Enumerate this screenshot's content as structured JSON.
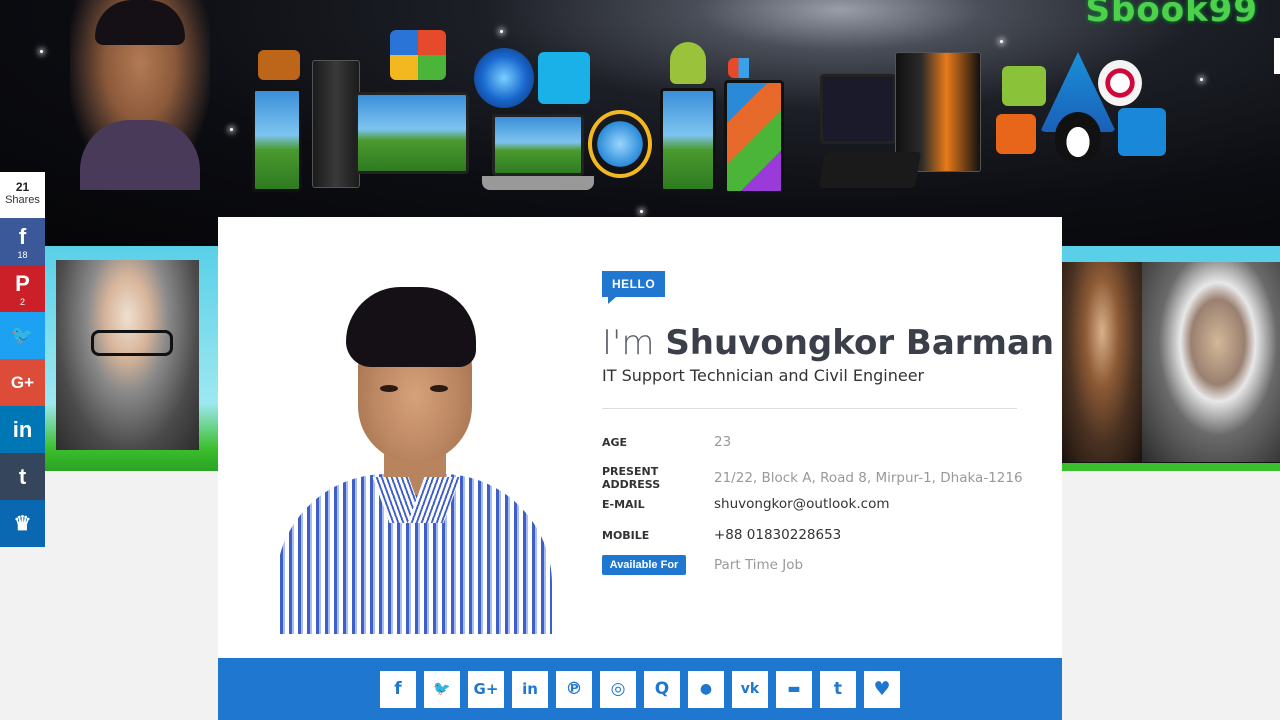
{
  "banner": {
    "brand": "Sbook99"
  },
  "share": {
    "count": "21",
    "count_label": "Shares",
    "buttons": [
      {
        "network": "facebook",
        "glyph": "f",
        "count": "18",
        "color": "#3b5998"
      },
      {
        "network": "pinterest",
        "glyph": "P",
        "count": "2",
        "color": "#cb2027"
      },
      {
        "network": "twitter",
        "glyph": "🐦",
        "count": "",
        "color": "#1da1f2"
      },
      {
        "network": "google-plus",
        "glyph": "G+",
        "count": "",
        "color": "#dd4b39"
      },
      {
        "network": "linkedin",
        "glyph": "in",
        "count": "",
        "color": "#0077b5"
      },
      {
        "network": "tumblr",
        "glyph": "t",
        "count": "",
        "color": "#35465c"
      },
      {
        "network": "sumome",
        "glyph": "♛",
        "count": "",
        "color": "#0a67b1"
      }
    ]
  },
  "profile": {
    "hello": "HELLO",
    "name_prefix": "I'm",
    "name": "Shuvongkor Barman",
    "subtitle": "IT Support Technician and Civil Engineer",
    "fields": [
      {
        "label": "AGE",
        "value": "23"
      },
      {
        "label": "PRESENT ADDRESS",
        "value": "21/22, Block A, Road 8, Mirpur-1, Dhaka-1216"
      },
      {
        "label": "E-MAIL",
        "value": "shuvongkor@outlook.com"
      },
      {
        "label": "MOBILE",
        "value": "+88 01830228653"
      }
    ],
    "available_label": "Available For",
    "available_value": "Part Time Job"
  },
  "social": [
    {
      "name": "facebook",
      "glyph": "f"
    },
    {
      "name": "twitter",
      "glyph": "🐦"
    },
    {
      "name": "google-plus",
      "glyph": "G+"
    },
    {
      "name": "linkedin",
      "glyph": "in"
    },
    {
      "name": "pinterest",
      "glyph": "℗"
    },
    {
      "name": "instagram",
      "glyph": "◎"
    },
    {
      "name": "quora",
      "glyph": "Q"
    },
    {
      "name": "reddit",
      "glyph": "●"
    },
    {
      "name": "vk",
      "glyph": "vk"
    },
    {
      "name": "blogger",
      "glyph": "▬"
    },
    {
      "name": "tumblr",
      "glyph": "t"
    },
    {
      "name": "favorite",
      "glyph": "♥"
    }
  ],
  "colors": {
    "accent": "#1f77d0"
  }
}
